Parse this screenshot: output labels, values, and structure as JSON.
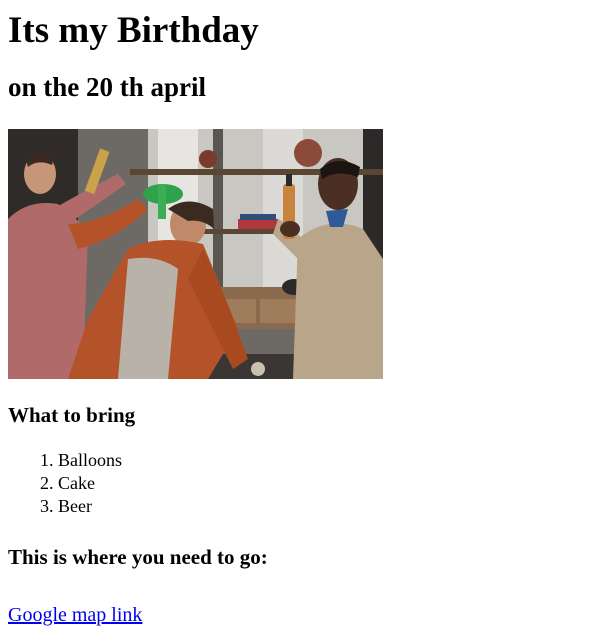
{
  "page": {
    "title": "Its my Birthday",
    "subtitle": "on the 20 th april"
  },
  "hero_image": {
    "description_icon": "party-photo",
    "alt": ""
  },
  "bring": {
    "heading": "What to bring",
    "items": [
      "Balloons",
      "Cake",
      "Beer"
    ]
  },
  "directions": {
    "heading": "This is where you need to go:",
    "link_text": "Google map link"
  },
  "colors": {
    "link": "#0000ee",
    "text": "#000000",
    "background": "#ffffff"
  }
}
